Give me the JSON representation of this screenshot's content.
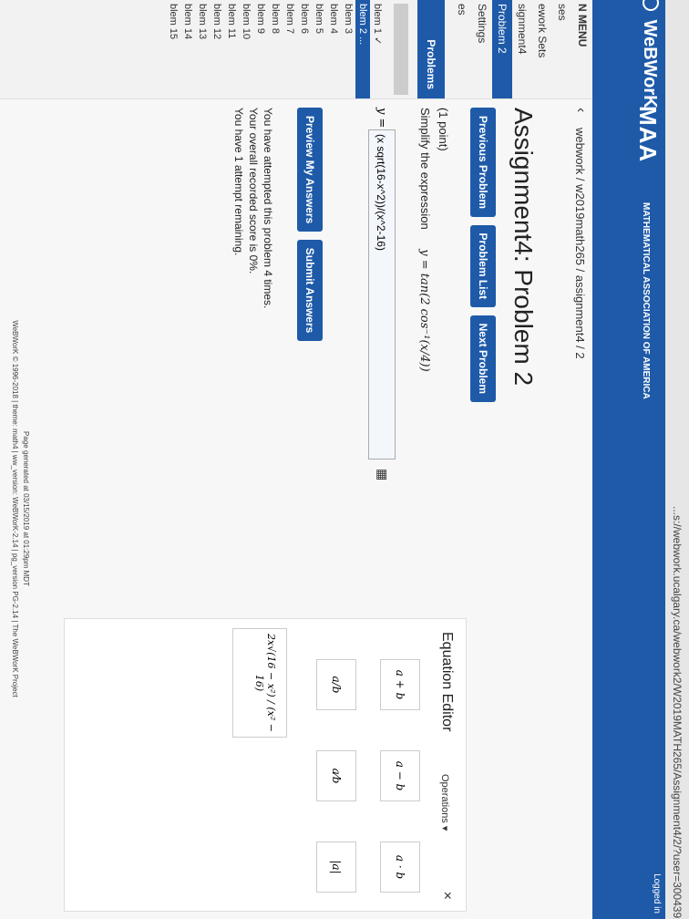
{
  "browser": {
    "url": "...s://webwork.ucalgary.ca/webwork2/W2019MATH265/Assignment4/2/?user=30043928&effe..."
  },
  "header": {
    "brand": "WeBWorK",
    "maa_logo": "MAA",
    "maa_subtitle": "MATHEMATICAL ASSOCIATION OF AMERICA",
    "logged_in": "Logged in"
  },
  "sidebar": {
    "menu_title": "N MENU",
    "items": [
      "ses",
      "ework Sets",
      "signment4",
      "Problem 2",
      "Settings",
      "es"
    ],
    "problems_heading": "Problems",
    "problem_list": [
      "blem 1 ✓",
      "blem 2 ...",
      "blem 3",
      "blem 4",
      "blem 5",
      "blem 6",
      "blem 7",
      "blem 8",
      "blem 9",
      "blem 10",
      "blem 11",
      "blem 12",
      "blem 13",
      "blem 14",
      "blem 15"
    ]
  },
  "breadcrumb": "webwork / w2019math265 / assignment4 / 2",
  "page_title": "Assignment4: Problem 2",
  "nav": {
    "previous": "Previous Problem",
    "list": "Problem List",
    "next": "Next Problem"
  },
  "problem": {
    "points": "(1 point)",
    "instruction": "Simplify the expression",
    "expression": "y = tan(2 cos⁻¹(x/4))",
    "answer_label": "y =",
    "answer_value": "(x sqrt(16-x^2))/(x^2-16)"
  },
  "actions": {
    "preview": "Preview My Answers",
    "submit": "Submit Answers"
  },
  "status": {
    "line1": "You have attempted this problem 4 times.",
    "line2": "Your overall recorded score is 0%.",
    "line3": "You have 1 attempt remaining."
  },
  "footer": {
    "line1": "Page generated at 03/15/2019 at 01:29pm MDT",
    "line2": "WeBWorK © 1996-2018 | theme: math4 | ww_version: WeBWorK-2.14 | pg_version PG-2.14 | The WeBWorK Project"
  },
  "equation_editor": {
    "title": "Equation Editor",
    "operations": "Operations ▾",
    "close": "×",
    "cells": [
      "a + b",
      "a − b",
      "a · b",
      "a/b",
      "a⁄b",
      "|a|"
    ],
    "preview": "2x√(16 − x²) / (x² − 16)"
  }
}
